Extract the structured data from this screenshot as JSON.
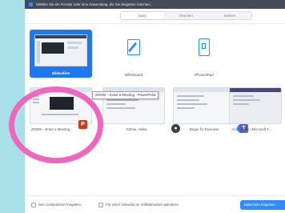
{
  "window": {
    "title": "Wählen Sie ein Fenster oder eine Anwendung, die Sie freigeben möchten."
  },
  "tabs": [
    {
      "label": "Basic",
      "active": true
    },
    {
      "label": "Erweitert",
      "active": false
    },
    {
      "label": "Dateien",
      "active": false
    }
  ],
  "tiles": [
    {
      "label": "Bildschirm",
      "icon": "monitor-icon",
      "selected": true
    },
    {
      "label": "Whiteboard",
      "icon": "whiteboard-icon",
      "selected": false
    },
    {
      "label": "iPhone/iPad",
      "icon": "ipad-icon",
      "selected": false
    },
    {
      "label": "ZOOM – Enter a Meeting...",
      "icon": "powerpoint-icon",
      "selected": false
    },
    {
      "label": "Kühne, Heike",
      "icon": "camera-icon",
      "selected": false
    },
    {
      "label": "Skype for Business",
      "icon": "skype-icon",
      "selected": false
    },
    {
      "label": "Core-Team | Microsoft T...",
      "icon": "teams-icon",
      "selected": false
    }
  ],
  "tooltip": "ZOOM – Enter a Meeting - PowerPoint",
  "bottom": {
    "computer_sound": "Den Computerton freigeben",
    "optimize_video": "Für einen Videoclip im Vollbildmodus optimieren",
    "share_button": "Bildschirm freigeben"
  },
  "colors": {
    "accent": "#2d8cff",
    "highlight": "#ee66be",
    "titlebar": "#434a57"
  }
}
